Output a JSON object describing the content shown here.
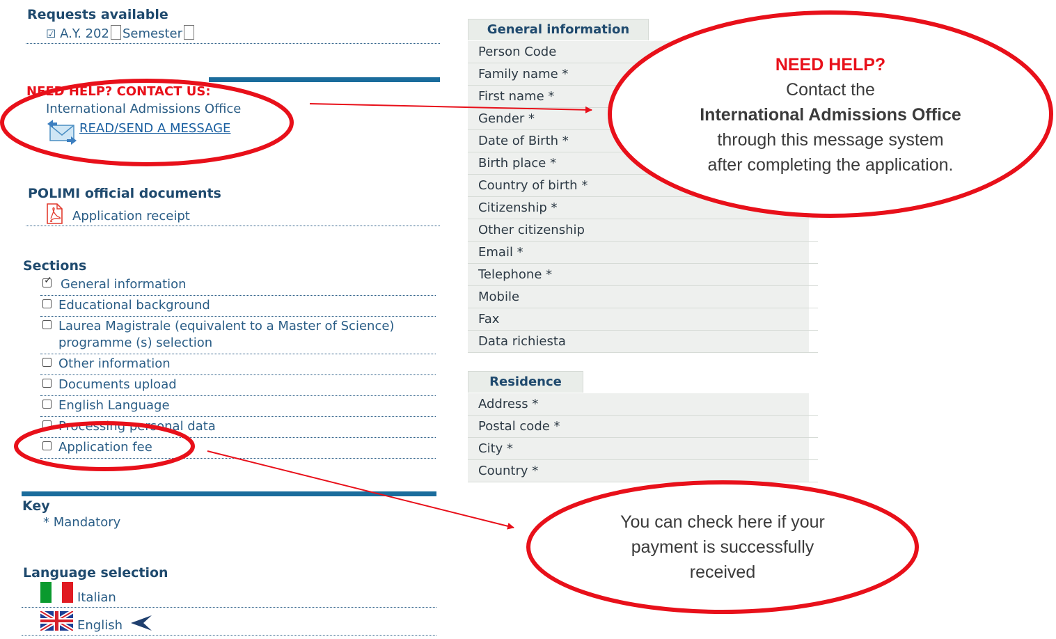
{
  "left": {
    "requests": {
      "title": "Requests available",
      "ay_label": "A.Y. 202",
      "semester_label": "Semester"
    },
    "help": {
      "title": "NEED HELP? CONTACT US:",
      "office": "International Admissions Office",
      "message_link": "READ/SEND A MESSAGE"
    },
    "documents": {
      "title": "POLIMI official documents",
      "receipt": "Application receipt"
    },
    "sections": {
      "title": "Sections",
      "items": [
        {
          "label": "General information",
          "checked": true
        },
        {
          "label": "Educational background",
          "checked": false
        },
        {
          "label": "Laurea Magistrale (equivalent to a Master of Science)",
          "label2": "programme (s) selection",
          "checked": false
        },
        {
          "label": "Other information",
          "checked": false
        },
        {
          "label": "Documents upload",
          "checked": false
        },
        {
          "label": "English Language",
          "checked": false
        },
        {
          "label": "Processing personal data",
          "checked": false
        },
        {
          "label": "Application fee",
          "checked": false
        }
      ]
    },
    "key": {
      "title": "Key",
      "mandatory": "* Mandatory"
    },
    "language": {
      "title": "Language selection",
      "italian": "Italian",
      "english": "English"
    }
  },
  "form": {
    "general_header": "General information",
    "general_fields": [
      "Person Code",
      "Family name *",
      "First name *",
      "Gender *",
      "Date of Birth  *",
      "Birth place *",
      "Country of birth *",
      "Citizenship *",
      "Other citizenship",
      "Email *",
      "Telephone *",
      "Mobile",
      "Fax",
      "Data richiesta"
    ],
    "residence_header": "Residence",
    "residence_fields": [
      "Address *",
      "Postal code *",
      "City *",
      "Country *"
    ]
  },
  "callouts": {
    "help": {
      "title": "NEED HELP?",
      "line1": "Contact the",
      "line2": "International Admissions Office",
      "line3": "through this message system",
      "line4": "after completing the application."
    },
    "payment": {
      "line1": "You can check here if your",
      "line2": "payment is successfully",
      "line3": "received"
    }
  },
  "colors": {
    "accent_bar": "#1a6c9c",
    "highlight_red": "#e8101a",
    "help_title_red": "#e8101a"
  }
}
